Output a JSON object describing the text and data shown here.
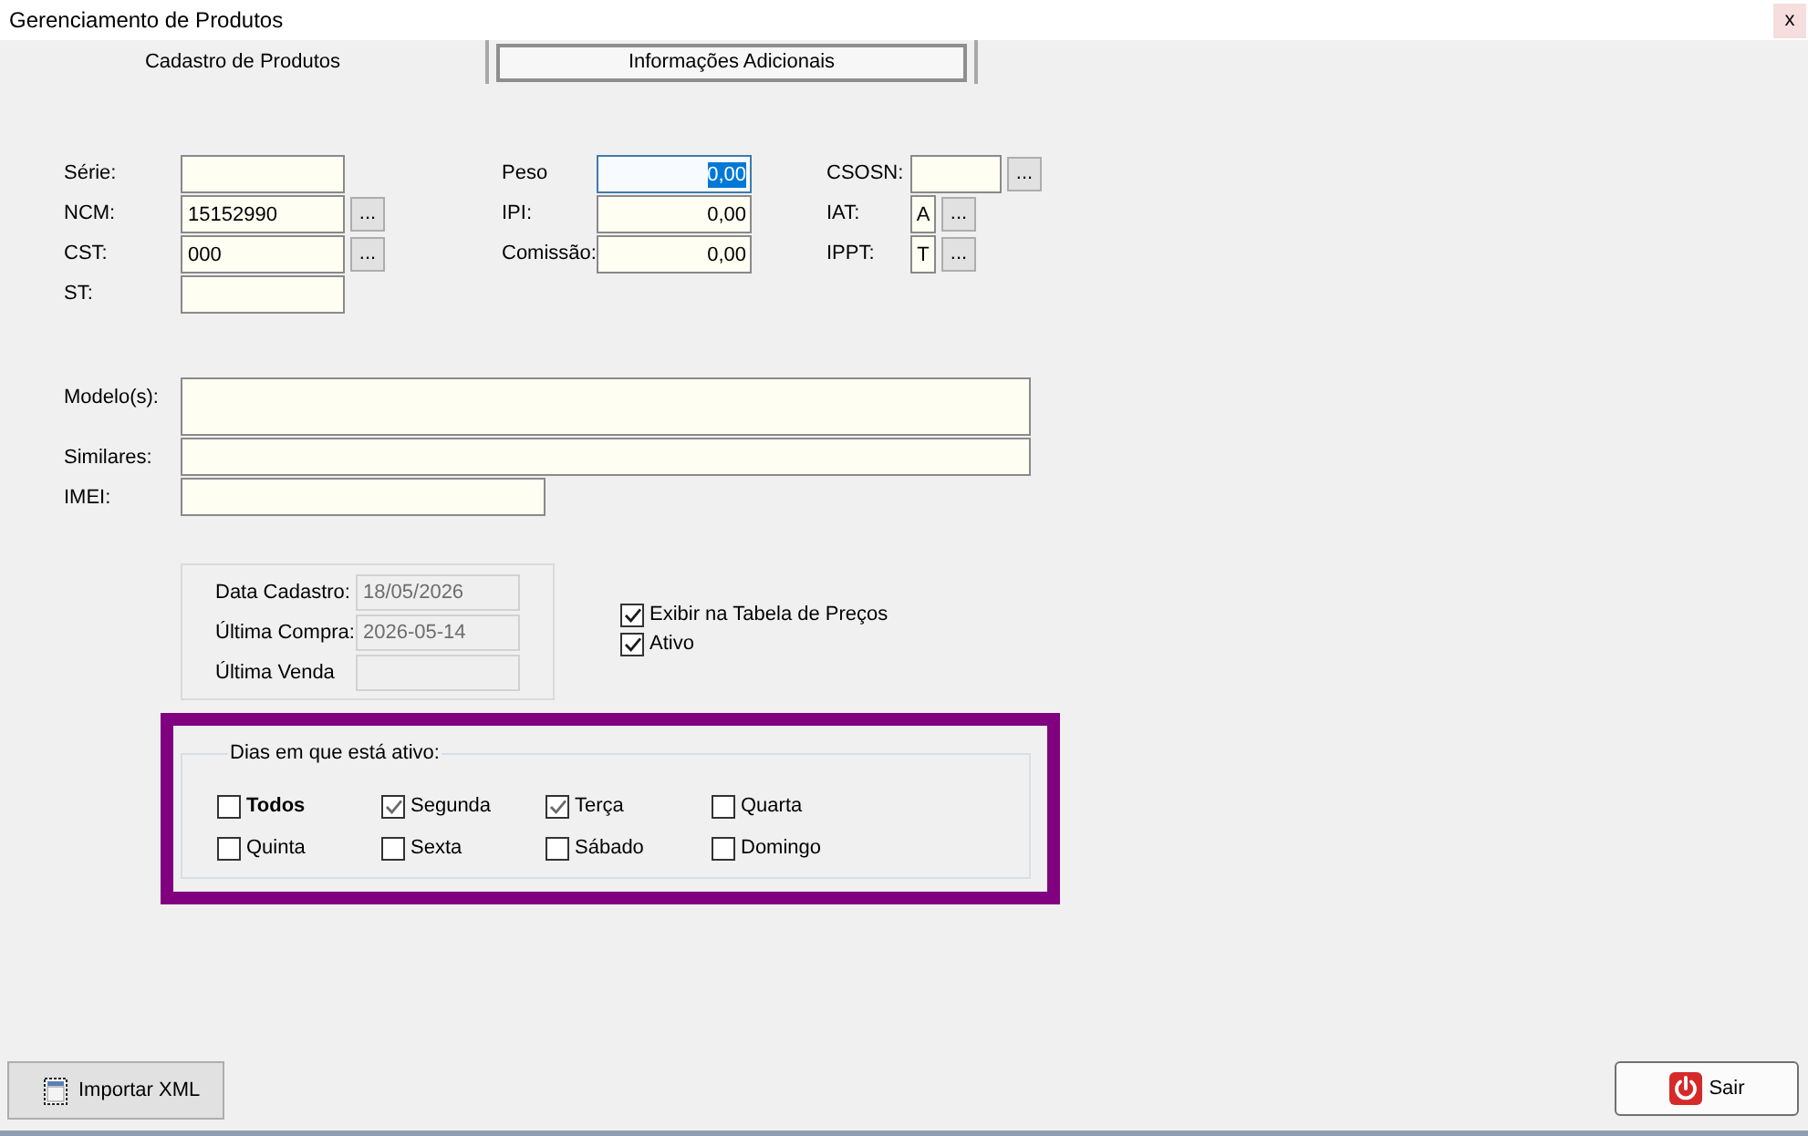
{
  "window": {
    "title": "Gerenciamento de Produtos",
    "close": "x"
  },
  "tabs": [
    {
      "label": "Cadastro de Produtos",
      "selected": false
    },
    {
      "label": "Informações Adicionais",
      "selected": true
    }
  ],
  "fiscal_columns": [
    {
      "fields": [
        {
          "label": "Série:",
          "focused": false
        },
        {
          "label": "NCM:",
          "value": "15152990",
          "button": "...",
          "focused": false
        },
        {
          "label": "CST:",
          "value": "000",
          "button": "...",
          "focused": false
        },
        {
          "label": "ST:",
          "focused": false
        }
      ]
    },
    {
      "fields": [
        {
          "label": "Peso",
          "value": "0,00",
          "focused": true
        },
        {
          "label": "IPI:",
          "value": "0,00",
          "focused": false
        },
        {
          "label": "Comissão:",
          "value": "0,00",
          "focused": false
        }
      ]
    },
    {
      "fields": [
        {
          "label": "CSOSN:",
          "button": "...",
          "focused": false
        },
        {
          "label": "IAT:",
          "value": "A",
          "button": "...",
          "focused": false
        },
        {
          "label": "IPPT:",
          "value": "T",
          "button": "...",
          "focused": false
        }
      ]
    }
  ],
  "descriptions": [
    {
      "label": "Modelo(s):",
      "kind": "memo"
    },
    {
      "label": "Similares:",
      "kind": "wide"
    },
    {
      "label": "IMEI:",
      "kind": "short"
    }
  ],
  "dates": [
    {
      "label": "Data Cadastro:",
      "value": "18/05/2026",
      "disabled": true
    },
    {
      "label": "Última Compra:",
      "value": "2026-05-14",
      "disabled": true
    },
    {
      "label": "Última Venda",
      "disabled": true
    }
  ],
  "flags": [
    {
      "label": "Exibir na Tabela de Preços",
      "checked": true
    },
    {
      "label": "Ativo",
      "checked": true
    }
  ],
  "active_days": {
    "title": "Dias em que está ativo:",
    "highlighted": true,
    "days": [
      {
        "label": "Todos",
        "kind": "all",
        "checked": false
      },
      {
        "label": "Segunda",
        "kind": "day",
        "checked": true
      },
      {
        "label": "Terça",
        "kind": "day",
        "checked": true
      },
      {
        "label": "Quarta",
        "kind": "day",
        "checked": false
      },
      {
        "label": "Quinta",
        "kind": "day",
        "checked": false
      },
      {
        "label": "Sexta",
        "kind": "day",
        "checked": false
      },
      {
        "label": "Sábado",
        "kind": "day",
        "checked": false
      },
      {
        "label": "Domingo",
        "kind": "day",
        "checked": false
      }
    ]
  },
  "buttons": [
    {
      "label": "Importar XML",
      "kind": "import"
    },
    {
      "label": "Sair",
      "kind": "exit"
    }
  ]
}
